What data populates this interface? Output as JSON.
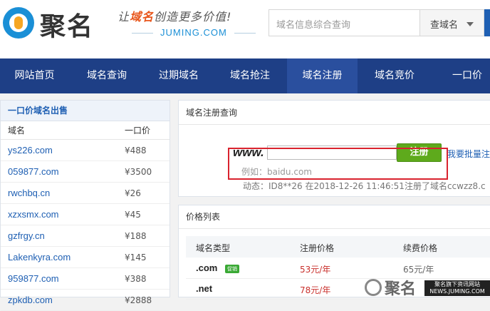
{
  "brand": {
    "logo_text": "聚名",
    "slogan_prefix": "让",
    "slogan_highlight": "域名",
    "slogan_suffix": "创造更多价值!",
    "domain": "JUMING.COM"
  },
  "search": {
    "placeholder": "域名信息综合查询",
    "type_label": "查域名"
  },
  "nav": {
    "items": [
      "网站首页",
      "域名查询",
      "过期域名",
      "域名抢注",
      "域名注册",
      "域名竞价",
      "一口价"
    ],
    "active": "域名注册"
  },
  "fixed_price_list": {
    "title": "一口价域名出售",
    "col_domain": "域名",
    "col_price": "一口价",
    "rows": [
      {
        "domain": "ys226.com",
        "price": "¥488"
      },
      {
        "domain": "059877.com",
        "price": "¥3500"
      },
      {
        "domain": "rwchbq.cn",
        "price": "¥26"
      },
      {
        "domain": "xzxsmx.com",
        "price": "¥45"
      },
      {
        "domain": "gzfrgy.cn",
        "price": "¥188"
      },
      {
        "domain": "Lakenkyra.com",
        "price": "¥145"
      },
      {
        "domain": "959877.com",
        "price": "¥388"
      },
      {
        "domain": "zpkdb.com",
        "price": "¥2888"
      }
    ]
  },
  "register": {
    "title": "域名注册查询",
    "www_prefix": "www.",
    "button_label": "注册",
    "example": "例如：baidu.com",
    "bulk_link": "我要批量注",
    "dynamic": "动态：ID8**26 在2018-12-26 11:46:51注册了域名ccwzz8.c"
  },
  "price_list": {
    "title": "价格列表",
    "col_type": "域名类型",
    "col_reg": "注册价格",
    "col_renew": "续费价格",
    "rows": [
      {
        "type": ".com",
        "badge": "促销",
        "reg": "53元/年",
        "renew": "65元/年"
      },
      {
        "type": ".net",
        "badge": "",
        "reg": "78元/年",
        "renew": ""
      }
    ]
  },
  "watermark": {
    "text": "聚名",
    "sub": "聚名旗下资讯网站 NEWS.JUMING.COM"
  }
}
